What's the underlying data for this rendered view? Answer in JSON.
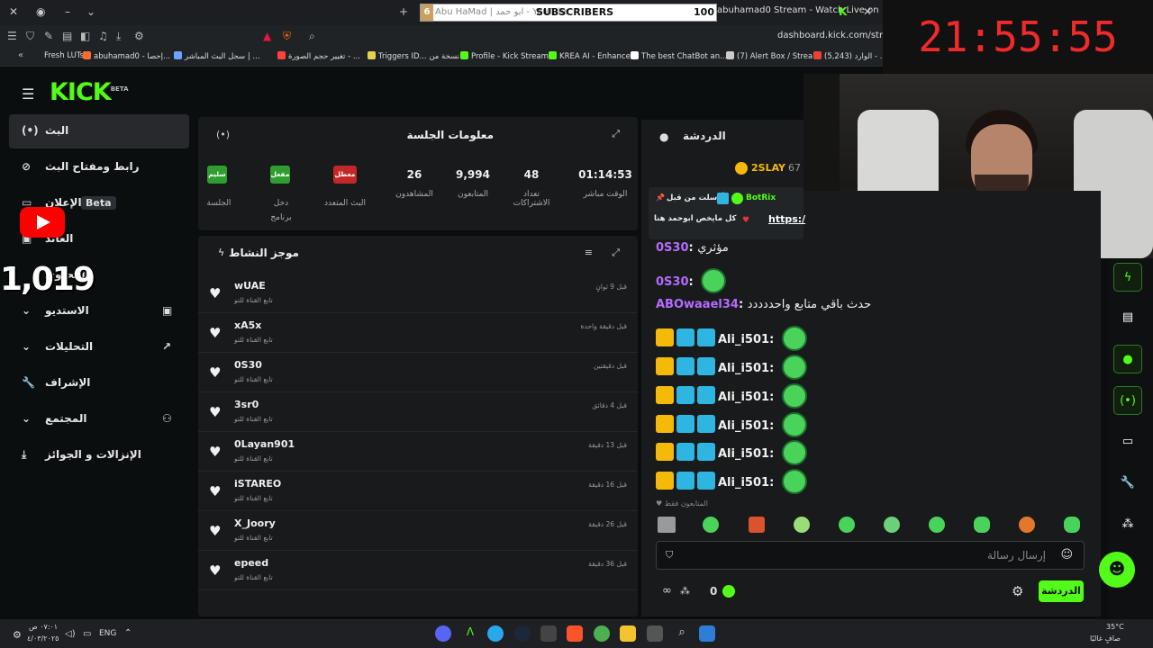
{
  "browser": {
    "tab_youtube": {
      "count": "6",
      "title": "Abu HaMad | ابو حمد - YouTube",
      "overlay": "SUBSCRIBERS",
      "overlay_value": "100"
    },
    "tab_kick": "abuhamad0 Stream - Watch Live on",
    "url": "dashboard.kick.com/stream",
    "bookmarks": [
      {
        "label": "Fresh LUTs",
        "color": "#ff6b2b"
      },
      {
        "label": "abuhamad0 - إحصا...",
        "color": "#6ba3ff"
      },
      {
        "label": "سجل البث المباشر | ...",
        "color": "#ff4040"
      },
      {
        "label": "تغيير حجم الصورة - ...",
        "color": "#e6d24a"
      },
      {
        "label": "Triggers ID... نسخة من",
        "color": "#3ac8ff"
      },
      {
        "label": "Profile - Kick Stream...",
        "color": "#53fc18"
      },
      {
        "label": "KREA AI - Enhancer",
        "color": "#53fc18"
      },
      {
        "label": "The best ChatBot an...",
        "color": "#ffffff"
      },
      {
        "label": "(7) Alert Box / Strea...",
        "color": "#cccccc"
      },
      {
        "label": "(5,243) الوارد - ...",
        "color": "#ea4335"
      }
    ]
  },
  "clock": "21:55:55",
  "youtube_overlay": {
    "count": "1,019"
  },
  "kick": {
    "logo": "KICK",
    "logo_badge": "BETA",
    "nav": [
      {
        "label": "البث",
        "icon": "broadcast-icon"
      },
      {
        "label": "رابط ومفتاح البث",
        "icon": "link-icon"
      },
      {
        "label": "الإعلان",
        "badge": "Beta",
        "icon": "ad-icon"
      },
      {
        "label": "العائد",
        "icon": "revenue-icon"
      },
      {
        "label": "المحتوى",
        "icon": "content-icon"
      },
      {
        "label": "الاستديو",
        "icon": "studio-icon"
      },
      {
        "label": "التحليلات",
        "icon": "analytics-icon"
      },
      {
        "label": "الإشراف",
        "icon": "wrench-icon"
      },
      {
        "label": "المجتمع",
        "icon": "community-icon"
      },
      {
        "label": "الإنزالات و الجوائز",
        "icon": "drops-icon"
      }
    ],
    "session": {
      "title": "معلومات الجلسة",
      "stats": [
        {
          "value": "01:14:53",
          "label": "الوقت مباشر"
        },
        {
          "value": "48",
          "label": "تعداد الاشتراكات"
        },
        {
          "value": "9,994",
          "label": "المتابعون"
        },
        {
          "value": "26",
          "label": "المشاهدون"
        }
      ],
      "badges": [
        {
          "badge": "معطل",
          "label": "البث المتعدد",
          "color": "#c42727"
        },
        {
          "badge": "مفعل",
          "label": "دخل برنامج الشركاء",
          "color": "#2e9e2e"
        },
        {
          "badge": "سليم",
          "label": "الجلسة",
          "color": "#2e9e2e"
        }
      ]
    },
    "activity": {
      "title": "موجز النشاط",
      "sub_label": "تابع القناة للتو",
      "rows": [
        {
          "name": "wUAE",
          "time": "قبل 9 ثوانٍ"
        },
        {
          "name": "xA5x",
          "time": "قبل دقيقة واحدة"
        },
        {
          "name": "0S30",
          "time": "قبل دقيقتين"
        },
        {
          "name": "3sr0",
          "time": "قبل 4 دقائق"
        },
        {
          "name": "0Layan901",
          "time": "قبل 13 دقيقة"
        },
        {
          "name": "iSTAREO",
          "time": "قبل 16 دقيقة"
        },
        {
          "name": "X_Joory",
          "time": "قبل 26 دقيقة"
        },
        {
          "name": "epeed",
          "time": "قبل 36 دقيقة"
        }
      ]
    },
    "chat": {
      "title": "الدردشة",
      "top_user": "2SLAY",
      "top_count": "67",
      "pinned_by": "أرسلت من قبل",
      "pinned_user": "BotRix",
      "pinned_text": "كل مايخص ابوحمد هنا",
      "pinned_link": "https:/",
      "messages": [
        {
          "user": "0S30",
          "text": "مؤثري",
          "partial": true
        },
        {
          "user": "0S30",
          "text": ""
        },
        {
          "user": "ABOwaael34",
          "text": "حدث باقي متابع واحددددد"
        },
        {
          "user": "Ali_i501",
          "text": ""
        },
        {
          "user": "Ali_i501",
          "text": ""
        },
        {
          "user": "Ali_i501",
          "text": ""
        },
        {
          "user": "Ali_i501",
          "text": ""
        },
        {
          "user": "Ali_i501",
          "text": ""
        },
        {
          "user": "Ali_i501",
          "text": ""
        }
      ],
      "followers_only": "المتابعون فقط",
      "input_placeholder": "إرسال رسالة",
      "send_label": "الدردشة",
      "points": "0"
    }
  },
  "taskbar": {
    "time": "٠٧:٠١ ص",
    "date": "٤/٠٣/٢٠٢٥",
    "lang": "ENG",
    "temp": "35°C",
    "weather": "صافٍ غالبًا"
  }
}
